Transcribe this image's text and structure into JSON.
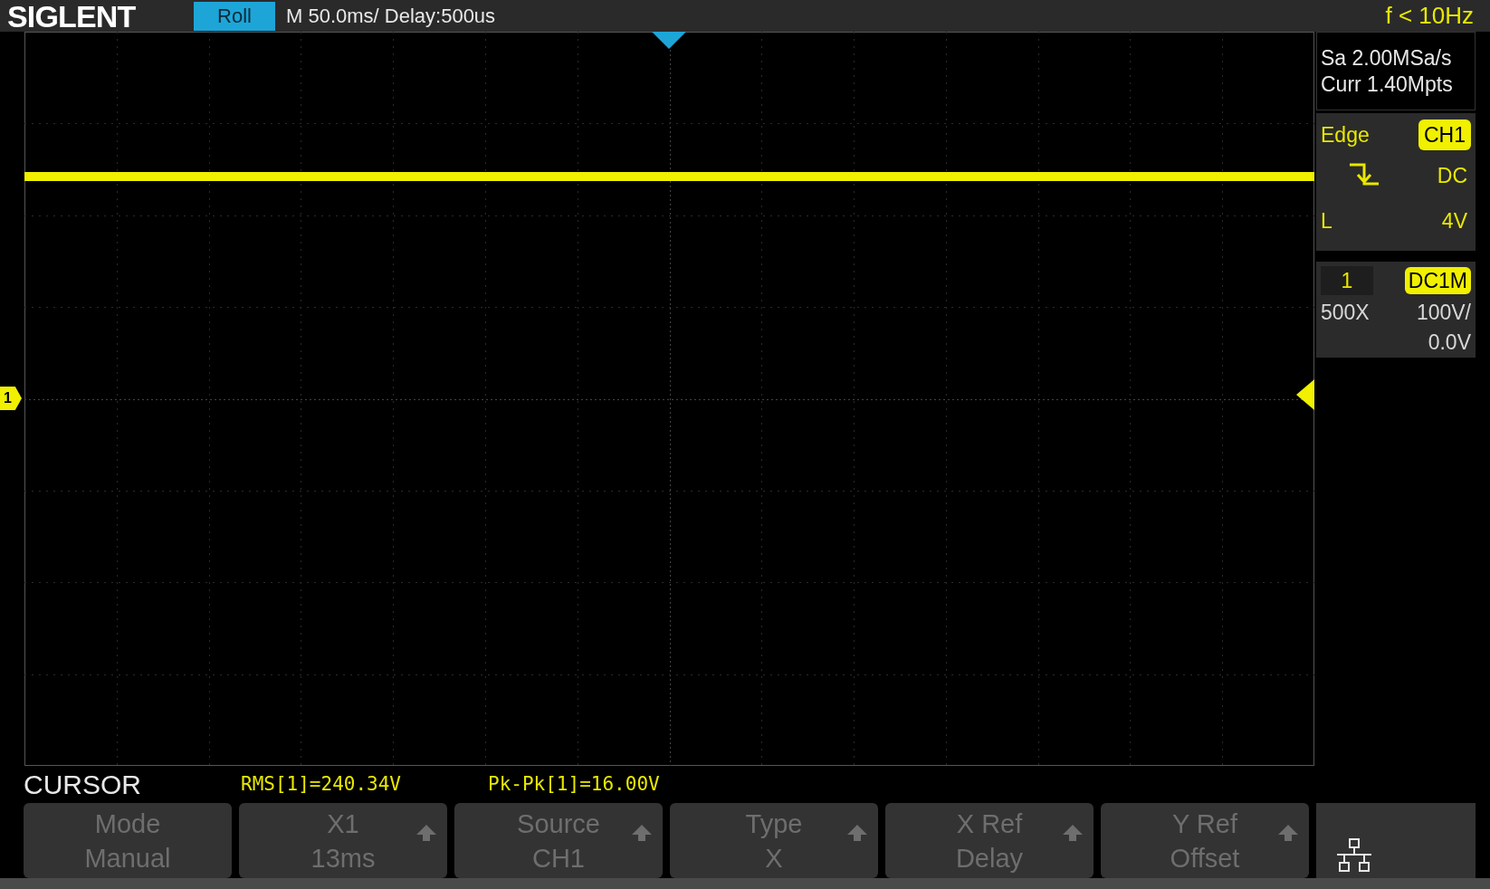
{
  "header": {
    "logo": "SIGLENT",
    "mode": "Roll",
    "timebase": "M 50.0ms/ Delay:500us",
    "frequency": "f < 10Hz"
  },
  "acquisition": {
    "sample_rate": "Sa 2.00MSa/s",
    "memory": "Curr 1.40Mpts"
  },
  "trigger": {
    "type": "Edge",
    "source": "CH1",
    "coupling": "DC",
    "level_label": "L",
    "level_value": "4V"
  },
  "channel": {
    "number": "1",
    "coupling": "DC1M",
    "probe": "500X",
    "scale": "100V/",
    "offset": "0.0V"
  },
  "channel_marker": "1",
  "measure": {
    "title": "CURSOR",
    "readings": [
      "RMS[1]=240.34V",
      "Pk-Pk[1]=16.00V"
    ]
  },
  "softkeys": [
    {
      "label": "Mode",
      "value": "Manual",
      "arrow": false
    },
    {
      "label": "X1",
      "value": "13ms",
      "arrow": true
    },
    {
      "label": "Source",
      "value": "CH1",
      "arrow": true
    },
    {
      "label": "Type",
      "value": "X",
      "arrow": true
    },
    {
      "label": "X Ref",
      "value": "Delay",
      "arrow": true
    },
    {
      "label": "Y Ref",
      "value": "Offset",
      "arrow": true
    }
  ]
}
